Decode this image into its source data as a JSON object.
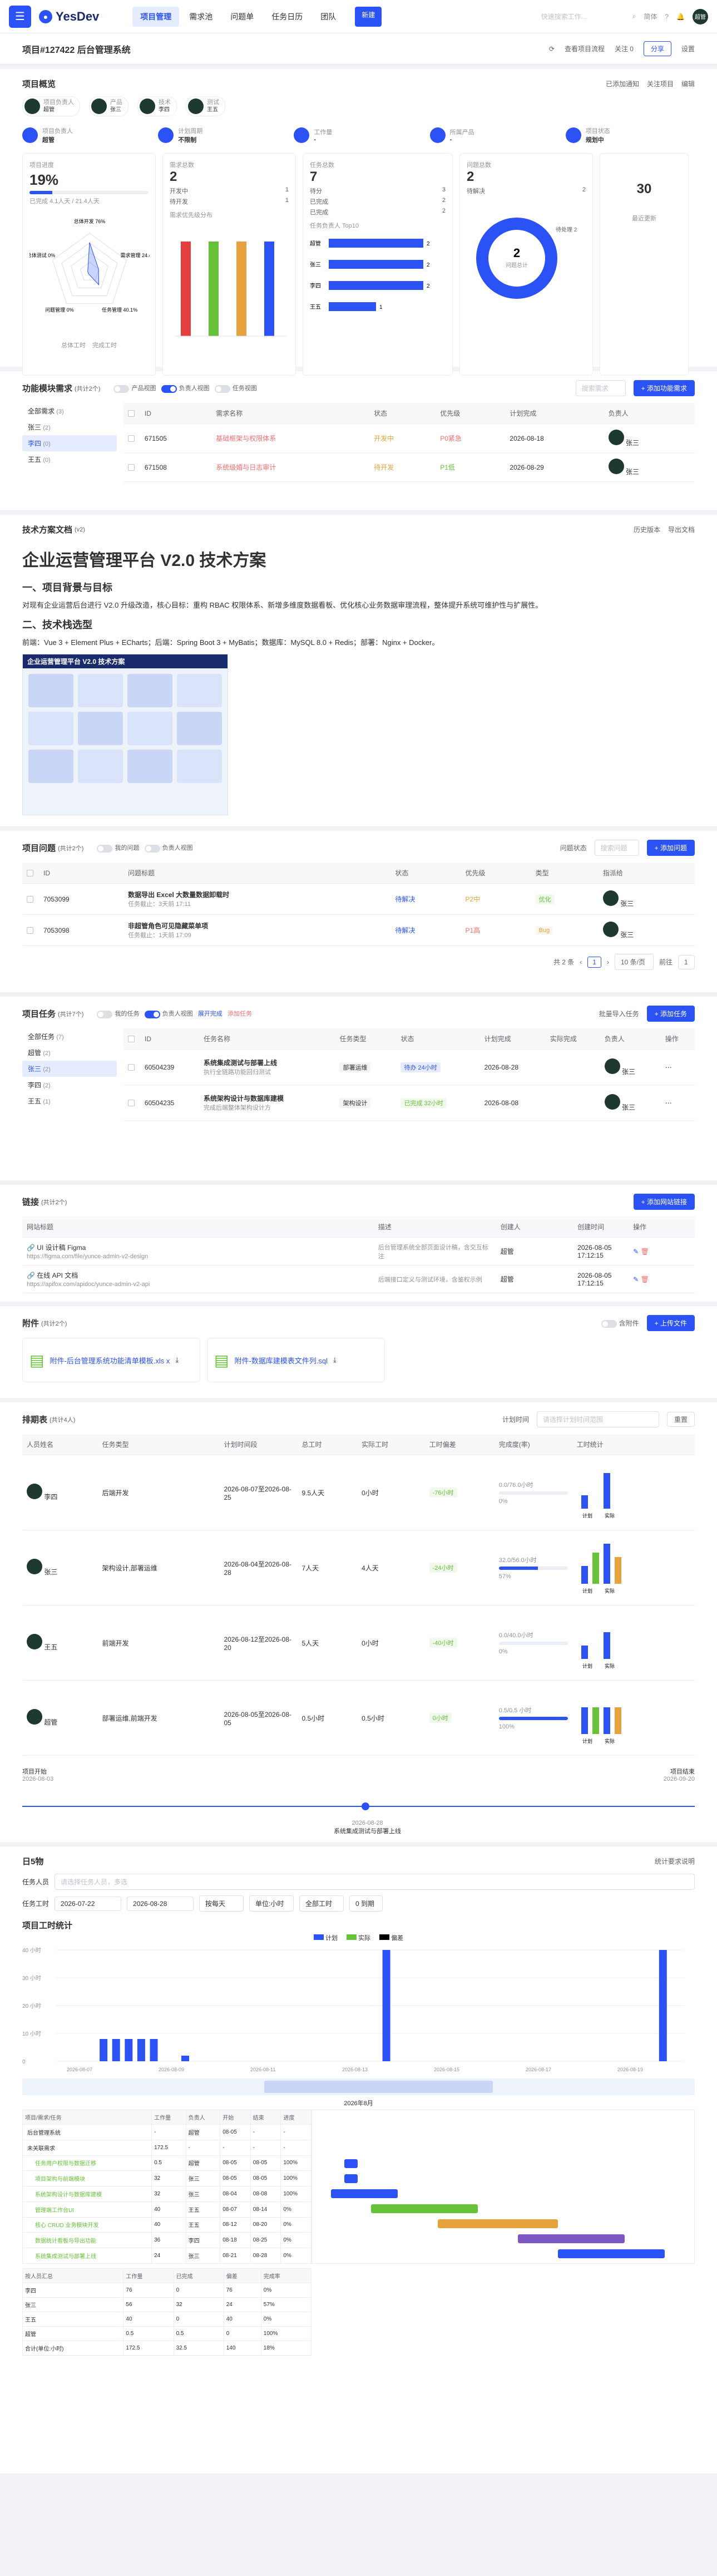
{
  "topbar": {
    "brand": "YesDev",
    "nav": [
      "项目管理",
      "需求池",
      "问题单",
      "任务日历",
      "团队"
    ],
    "nav_pill": "新建",
    "search_placeholder": "快速搜索工作...",
    "lang": "简体",
    "avatar": "超管"
  },
  "subbar": {
    "title": "项目#127422 后台管理系统",
    "follow": "查看项目流程",
    "attention": "关注 0",
    "share": "分享",
    "settings": "设置"
  },
  "overview": {
    "title": "项目概览",
    "links": [
      "已添加通知",
      "关注项目",
      "编辑"
    ],
    "members": [
      {
        "role": "项目负责人",
        "name": "超管"
      },
      {
        "role": "产品",
        "name": "张三"
      },
      {
        "role": "技术",
        "name": "李四"
      },
      {
        "role": "测试",
        "name": "王五"
      }
    ],
    "info": [
      {
        "label": "项目负责人",
        "value": "超管"
      },
      {
        "label": "计划周期",
        "value": "不限制"
      },
      {
        "label": "工作量",
        "value": "-"
      },
      {
        "label": "所属产品",
        "value": "-"
      },
      {
        "label": "项目状态",
        "value": "规划中"
      }
    ],
    "progress_label": "项目进度",
    "progress_value": "19%",
    "progress_sub": "已完成 4.1人天 / 21.4人天",
    "progress_fill": 0.19,
    "radar_labels": [
      "总体开发",
      "需求管理",
      "任务管理",
      "问题管理",
      "总体测试"
    ],
    "radar_values": [
      "76%",
      "24.4%",
      "40.1%",
      "0%",
      "0%"
    ],
    "radar_legend": [
      "总体工时",
      "完成工时"
    ],
    "req_title": "需求总数",
    "req_count": "2",
    "req_rows": [
      {
        "k": "开发中",
        "v": "1"
      },
      {
        "k": "待开发",
        "v": "1"
      }
    ],
    "req_chart_title": "需求优先级分布",
    "task_title": "任务总数",
    "task_count": "7",
    "task_rows": [
      {
        "k": "待分",
        "v": "3"
      },
      {
        "k": "已完成",
        "v": "2"
      },
      {
        "k": "已完成",
        "v": "2"
      }
    ],
    "task_chart_title": "任务负责人 Top10",
    "task_bars": [
      {
        "name": "超管",
        "v": 2
      },
      {
        "name": "张三",
        "v": 2
      },
      {
        "name": "李四",
        "v": 2
      },
      {
        "name": "王五",
        "v": 1
      }
    ],
    "bug_title": "问题总数",
    "bug_count": "2",
    "bug_rows": [
      {
        "k": "待解决",
        "v": "2"
      }
    ],
    "bug_donut_center": "2",
    "bug_donut_label": "问题总计",
    "bug_donut_legend": "待处理 2",
    "days_value": "30",
    "days_label": "最近更新"
  },
  "features": {
    "title": "功能模块需求",
    "count": "(共计2个)",
    "filters": [
      "产品视图",
      "负责人视图",
      "任务视图"
    ],
    "search": "搜索需求",
    "add": "+ 添加功能需求",
    "sidebar": [
      "全部需求",
      "张三",
      "李四",
      "王五"
    ],
    "sidebar_counts": [
      "3",
      "2",
      "0",
      "0"
    ],
    "cols": [
      "ID",
      "需求名称",
      "状态",
      "优先级",
      "计划完成",
      "负责人"
    ],
    "rows": [
      {
        "id": "671505",
        "name": "基础框架与权限体系",
        "status": "开发中",
        "pri": "P0紧急",
        "date": "2026-08-18",
        "owner": "张三"
      },
      {
        "id": "671508",
        "name": "系统级婚与日志审计",
        "status": "待开发",
        "pri": "P1低",
        "date": "2026-08-29",
        "owner": "张三"
      }
    ]
  },
  "doc": {
    "title": "技术方案文档",
    "count": "(v2)",
    "actions": [
      "历史版本",
      "导出文档"
    ],
    "h1": "企业运营管理平台 V2.0 技术方案",
    "h2a": "一、项目背景与目标",
    "p1": "对现有企业运营后台进行 V2.0 升级改造，核心目标：重构 RBAC 权限体系、新增多维度数据看板、优化核心业务数据审理流程，整体提升系统可维护性与扩展性。",
    "h2b": "二、技术栈选型",
    "p2": "前端：Vue 3 + Element Plus + ECharts；后端：Spring Boot 3 + MyBatis；数据库：MySQL 8.0 + Redis；部署：Nginx + Docker。",
    "img_title": "企业运营管理平台 V2.0 技术方案"
  },
  "bugs": {
    "title": "项目问题",
    "count": "(共计2个)",
    "filters": [
      "我的问题",
      "负责人视图",
      "问题状态"
    ],
    "search": "搜索问题",
    "add": "+ 添加问题",
    "cols": [
      "ID",
      "问题标题",
      "状态",
      "优先级",
      "类型",
      "指派给"
    ],
    "rows": [
      {
        "id": "7053099",
        "title": "数据导出 Excel 大数量数据卸载时",
        "sub": "任务截止：3天前 17:11",
        "status": "待解决",
        "pri": "P2中",
        "type": "优化",
        "owner": "张三"
      },
      {
        "id": "7053098",
        "title": "非超管角色可见隐藏菜单项",
        "sub": "任务截止：1天前 17:09",
        "status": "待解决",
        "pri": "P1高",
        "type": "Bug",
        "owner": "张三"
      }
    ],
    "pager": "共 2 条",
    "page": "1",
    "size": "10 条/页",
    "goto": "前往",
    "goto_page": "1"
  },
  "tasks": {
    "title": "项目任务",
    "count": "(共计7个)",
    "filters": [
      "我的任务",
      "负责人视图",
      "展开完成",
      "添加任务"
    ],
    "search": "批量导入任务",
    "add": "+ 添加任务",
    "sidebar": [
      "全部任务",
      "超管",
      "张三",
      "李四",
      "王五"
    ],
    "sidebar_counts": [
      "7",
      "2",
      "2",
      "2",
      "1"
    ],
    "cols": [
      "ID",
      "任务名称",
      "任务类型",
      "状态",
      "计划完成",
      "实际完成",
      "负责人",
      "操作"
    ],
    "rows": [
      {
        "id": "60504239",
        "name": "系统集成测试与部署上线",
        "sub": "执行全链路功能回归测试",
        "type": "部署运维",
        "status": "待办 24小时",
        "plan": "2026-08-28",
        "owner": "张三"
      },
      {
        "id": "60504235",
        "name": "系统架构设计与数据库建模",
        "sub": "完成后端整体架构设计方",
        "type": "架构设计",
        "status": "已完成 32小时",
        "plan": "2026-08-08",
        "owner": "张三"
      }
    ]
  },
  "links": {
    "title": "链接",
    "count": "(共计2个)",
    "add": "+ 添加网站链接",
    "cols": [
      "网站标题",
      "描述",
      "创建人",
      "创建时间",
      "操作"
    ],
    "rows": [
      {
        "title": "UI 设计稿 Figma",
        "url": "https://figma.com/file/yunce-admin-v2-design",
        "desc": "后台管理系统全部页面设计稿，含交互标注",
        "creator": "超管",
        "time": "2026-08-05 17:12:15"
      },
      {
        "title": "在线 API 文档",
        "url": "https://apifox.com/apidoc/yunce-admin-v2-api",
        "desc": "后端接口定义与测试环境，含鉴权示例",
        "creator": "超管",
        "time": "2026-08-05 17:12:15"
      }
    ]
  },
  "files": {
    "title": "附件",
    "count": "(共计2个)",
    "toggle": "含附件",
    "add": "+ 上传文件",
    "items": [
      "附件-后台管理系统功能清单模板.xls x",
      "附件-数据库建模表文件列.sql"
    ]
  },
  "schedule": {
    "title": "排期表",
    "count": "(共计4人)",
    "plan_label": "计划时间",
    "plan_ph": "请选择计划时间范围",
    "reset": "重置",
    "cols": [
      "人员姓名",
      "任务类型",
      "计划时间段",
      "总工时",
      "实际工时",
      "工时偏差",
      "完成度(率)",
      "工时统计"
    ],
    "rows": [
      {
        "name": "李四",
        "type": "后端开发",
        "range": "2026-08-07至2026-08-25",
        "total": "9.5人天",
        "actual": "0小时",
        "dev": "-76小时",
        "done": "0.0/76.0小时",
        "rate": "0%",
        "bars": [
          3,
          0,
          8,
          0
        ]
      },
      {
        "name": "张三",
        "type": "架构设计,部署运维",
        "range": "2026-08-04至2026-08-28",
        "total": "7人天",
        "actual": "4人天",
        "dev": "-24小时",
        "done": "32.0/56.0小时",
        "rate": "57%",
        "bars": [
          4,
          7,
          9,
          6
        ]
      },
      {
        "name": "王五",
        "type": "前端开发",
        "range": "2026-08-12至2026-08-20",
        "total": "5人天",
        "actual": "0小时",
        "dev": "-40小时",
        "done": "0.0/40.0小时",
        "rate": "0%",
        "bars": [
          3,
          0,
          6,
          0
        ]
      },
      {
        "name": "超管",
        "type": "部署运维,前端开发",
        "range": "2026-08-05至2026-08-05",
        "total": "0.5小时",
        "actual": "0.5小时",
        "dev": "0小时",
        "done": "0.5/0.5 小时",
        "rate": "100%",
        "bars": [
          6,
          6,
          6,
          6
        ]
      }
    ],
    "bar_labels": [
      "计划",
      "实际"
    ],
    "timeline": {
      "start": "项目开始",
      "start_date": "2026-08-03",
      "end": "项目结束",
      "end_date": "2026-09-20",
      "mid_date": "2026-08-28",
      "mid_label": "系统集成测试与部署上线"
    }
  },
  "worktime": {
    "title": "日5物",
    "right": "统计要求说明",
    "person_label": "任务人员",
    "person_ph": "请选择任务人员，多选",
    "range_label": "任务工时",
    "from": "2026-07-22",
    "to": "2026-08-28",
    "group": "按每天",
    "unit": "单位:小时",
    "all": "全部工时",
    "zero": "0 到期",
    "chart_title": "项目工时统计",
    "legend": [
      "计划",
      "实际",
      "偏差"
    ],
    "yticks": [
      "40 小时",
      "30 小时",
      "20 小时",
      "10 小时",
      "0"
    ],
    "x_dates": [
      "2026-08-07",
      "2026-08-09",
      "2026-08-11",
      "2026-08-13",
      "2026-08-15",
      "2026-08-17",
      "2026-08-19"
    ],
    "bars": [
      {
        "x": 0.07,
        "v": 8
      },
      {
        "x": 0.09,
        "v": 8
      },
      {
        "x": 0.11,
        "v": 8
      },
      {
        "x": 0.13,
        "v": 8
      },
      {
        "x": 0.15,
        "v": 8
      },
      {
        "x": 0.2,
        "v": 2
      },
      {
        "x": 0.52,
        "v": 40
      },
      {
        "x": 0.96,
        "v": 40
      }
    ],
    "gantt_month": "2026年8月",
    "gantt_cols": [
      "项目/需求/任务",
      "工作量",
      "负责人",
      "开始",
      "结束",
      "进度"
    ],
    "gantt_rows": [
      {
        "name": "后台管理系统",
        "w": "-",
        "o": "超管",
        "s": "08-05",
        "e": "-",
        "p": "-",
        "lvl": 0
      },
      {
        "name": "未关联需求",
        "w": "172.5",
        "o": "-",
        "s": "-",
        "e": "-",
        "p": "-",
        "lvl": 0
      },
      {
        "name": "任务用户权限与数据迁移",
        "w": "0.5",
        "o": "超管",
        "s": "08-05",
        "e": "08-05",
        "p": "100%",
        "lvl": 1
      },
      {
        "name": "项目架构与前端模块",
        "w": "32",
        "o": "张三",
        "s": "08-05",
        "e": "08-05",
        "p": "100%",
        "lvl": 1
      },
      {
        "name": "系统架构设计与数据库建模",
        "w": "32",
        "o": "张三",
        "s": "08-04",
        "e": "08-08",
        "p": "100%",
        "lvl": 1
      },
      {
        "name": "管理端工作台UI",
        "w": "40",
        "o": "王五",
        "s": "08-07",
        "e": "08-14",
        "p": "0%",
        "lvl": 1
      },
      {
        "name": "核心 CRUD 业务模块开发",
        "w": "40",
        "o": "王五",
        "s": "08-12",
        "e": "08-20",
        "p": "0%",
        "lvl": 1
      },
      {
        "name": "数据统计看板与导出功能",
        "w": "36",
        "o": "李四",
        "s": "08-18",
        "e": "08-25",
        "p": "0%",
        "lvl": 1
      },
      {
        "name": "系统集成测试与部署上线",
        "w": "24",
        "o": "张三",
        "s": "08-21",
        "e": "08-28",
        "p": "0%",
        "lvl": 1
      }
    ],
    "sum_cols": [
      "按人员汇总",
      "工作量",
      "已完成",
      "偏差",
      "完成率"
    ],
    "sum_rows": [
      {
        "n": "李四",
        "w": "76",
        "d": "0",
        "dv": "76",
        "r": "0%"
      },
      {
        "n": "张三",
        "w": "56",
        "d": "32",
        "dv": "24",
        "r": "57%"
      },
      {
        "n": "王五",
        "w": "40",
        "d": "0",
        "dv": "40",
        "r": "0%"
      },
      {
        "n": "超管",
        "w": "0.5",
        "d": "0.5",
        "dv": "0",
        "r": "100%"
      },
      {
        "n": "合计(单位:小时)",
        "w": "172.5",
        "d": "32.5",
        "dv": "140",
        "r": "18%"
      }
    ]
  },
  "colors": {
    "accent": "#2b52f5",
    "red": "#f56c6c",
    "orange": "#e6a23c",
    "green": "#67c23a"
  }
}
